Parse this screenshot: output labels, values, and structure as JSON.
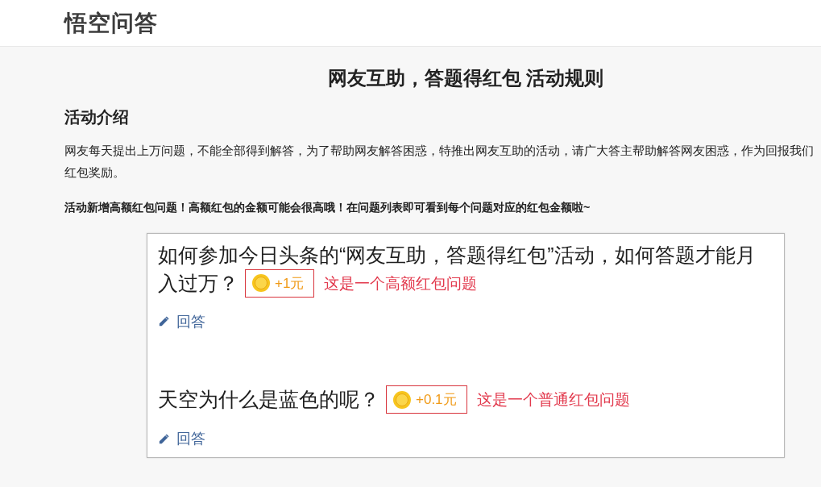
{
  "header": {
    "logo": "悟空问答"
  },
  "page_title": "网友互助，答题得红包 活动规则",
  "intro_section": {
    "heading": "活动介绍",
    "paragraph_lines": [
      "网友每天提出上万问题，不能全部得到解答，为了帮助网友解答困惑，特推出网友互助的活动，请广大答主帮助解答网友困惑，作为回报我们",
      "红包奖励。"
    ],
    "notice": "活动新增高额红包问题！高额红包的金额可能会很高哦！在问题列表即可看到每个问题对应的红包金额啦~"
  },
  "example_screenshot": {
    "questions": [
      {
        "title_lines": [
          "如何参加今日头条的“网友互助，答题得红包”活动，如何答题才能月",
          "入过万？"
        ],
        "reward": "+1元",
        "annotation": "这是一个高额红包问题",
        "answer_link": "回答"
      },
      {
        "title_lines": [
          "天空为什么是蓝色的呢？"
        ],
        "reward": "+0.1元",
        "annotation": "这是一个普通红包问题",
        "answer_link": "回答"
      }
    ]
  }
}
